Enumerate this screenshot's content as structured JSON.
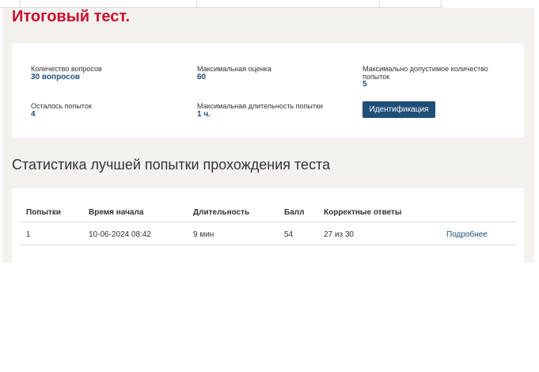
{
  "page_title": "Итоговый тест.",
  "info": {
    "questions_label": "Количество вопросов",
    "questions_value": "30 вопросов",
    "max_score_label": "Максимальная оценка",
    "max_score_value": "60",
    "max_attempts_label_line1": "Максимально допустимое количество",
    "max_attempts_label_line2": "попыток",
    "max_attempts_value": "5",
    "attempts_left_label": "Осталось попыток",
    "attempts_left_value": "4",
    "max_duration_label": "Максимальная длительность попытки",
    "max_duration_value": "1 ч.",
    "identify_button": "Идентификация"
  },
  "stats": {
    "title": "Статистика лучшей попытки прохождения теста",
    "headers": [
      "Попытки",
      "Время начала",
      "Длительность",
      "Балл",
      "Корректные ответы"
    ],
    "rows": [
      {
        "attempt": "1",
        "start": "10-06-2024 08:42",
        "duration": "9 мин",
        "score": "54",
        "correct": "27 из 30",
        "link": "Подробнее"
      }
    ]
  },
  "colors": {
    "title": "#c8102e",
    "accent": "#1f4e79",
    "panel_bg": "#f2f1ee"
  }
}
